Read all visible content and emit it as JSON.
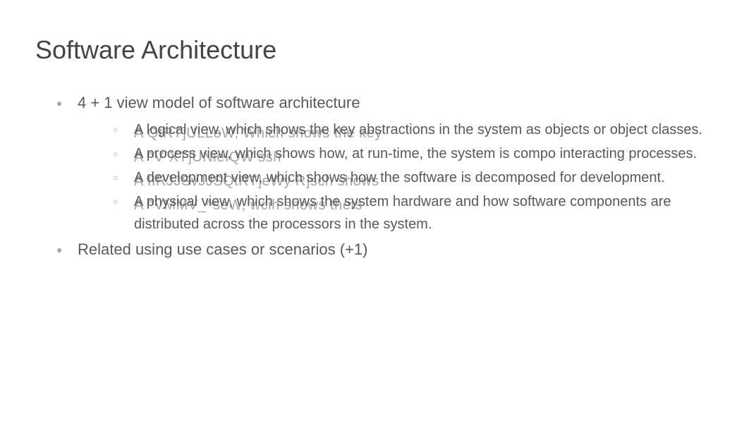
{
  "title": "Software Architecture",
  "bullets": {
    "main1": "4 + 1 view model of software architecture",
    "sub1": {
      "text": "A logical view, which shows the key abstractions in the system as objects or object classes.",
      "garble": "A QtRT]ULLeW, Which shows the key"
    },
    "sub2": {
      "text": "A process view, which shows how, at run-time, the system is compo interacting processes.",
      "garble": "A ^V`XT]UNieIQW ssh"
    },
    "sub3": {
      "text": "A development view, which shows how the software is decomposed for development.",
      "garble": "A IIRJJSvJJSQtRT]eWy R]sch shows"
    },
    "sub4": {
      "text": "A physical view, which shows the system hardware and how software components are distributed across the processors in the system.",
      "garble": "A ^VMMV_^seW, wcih shows thets"
    },
    "main2": "Related using use cases or scenarios (+1)"
  }
}
